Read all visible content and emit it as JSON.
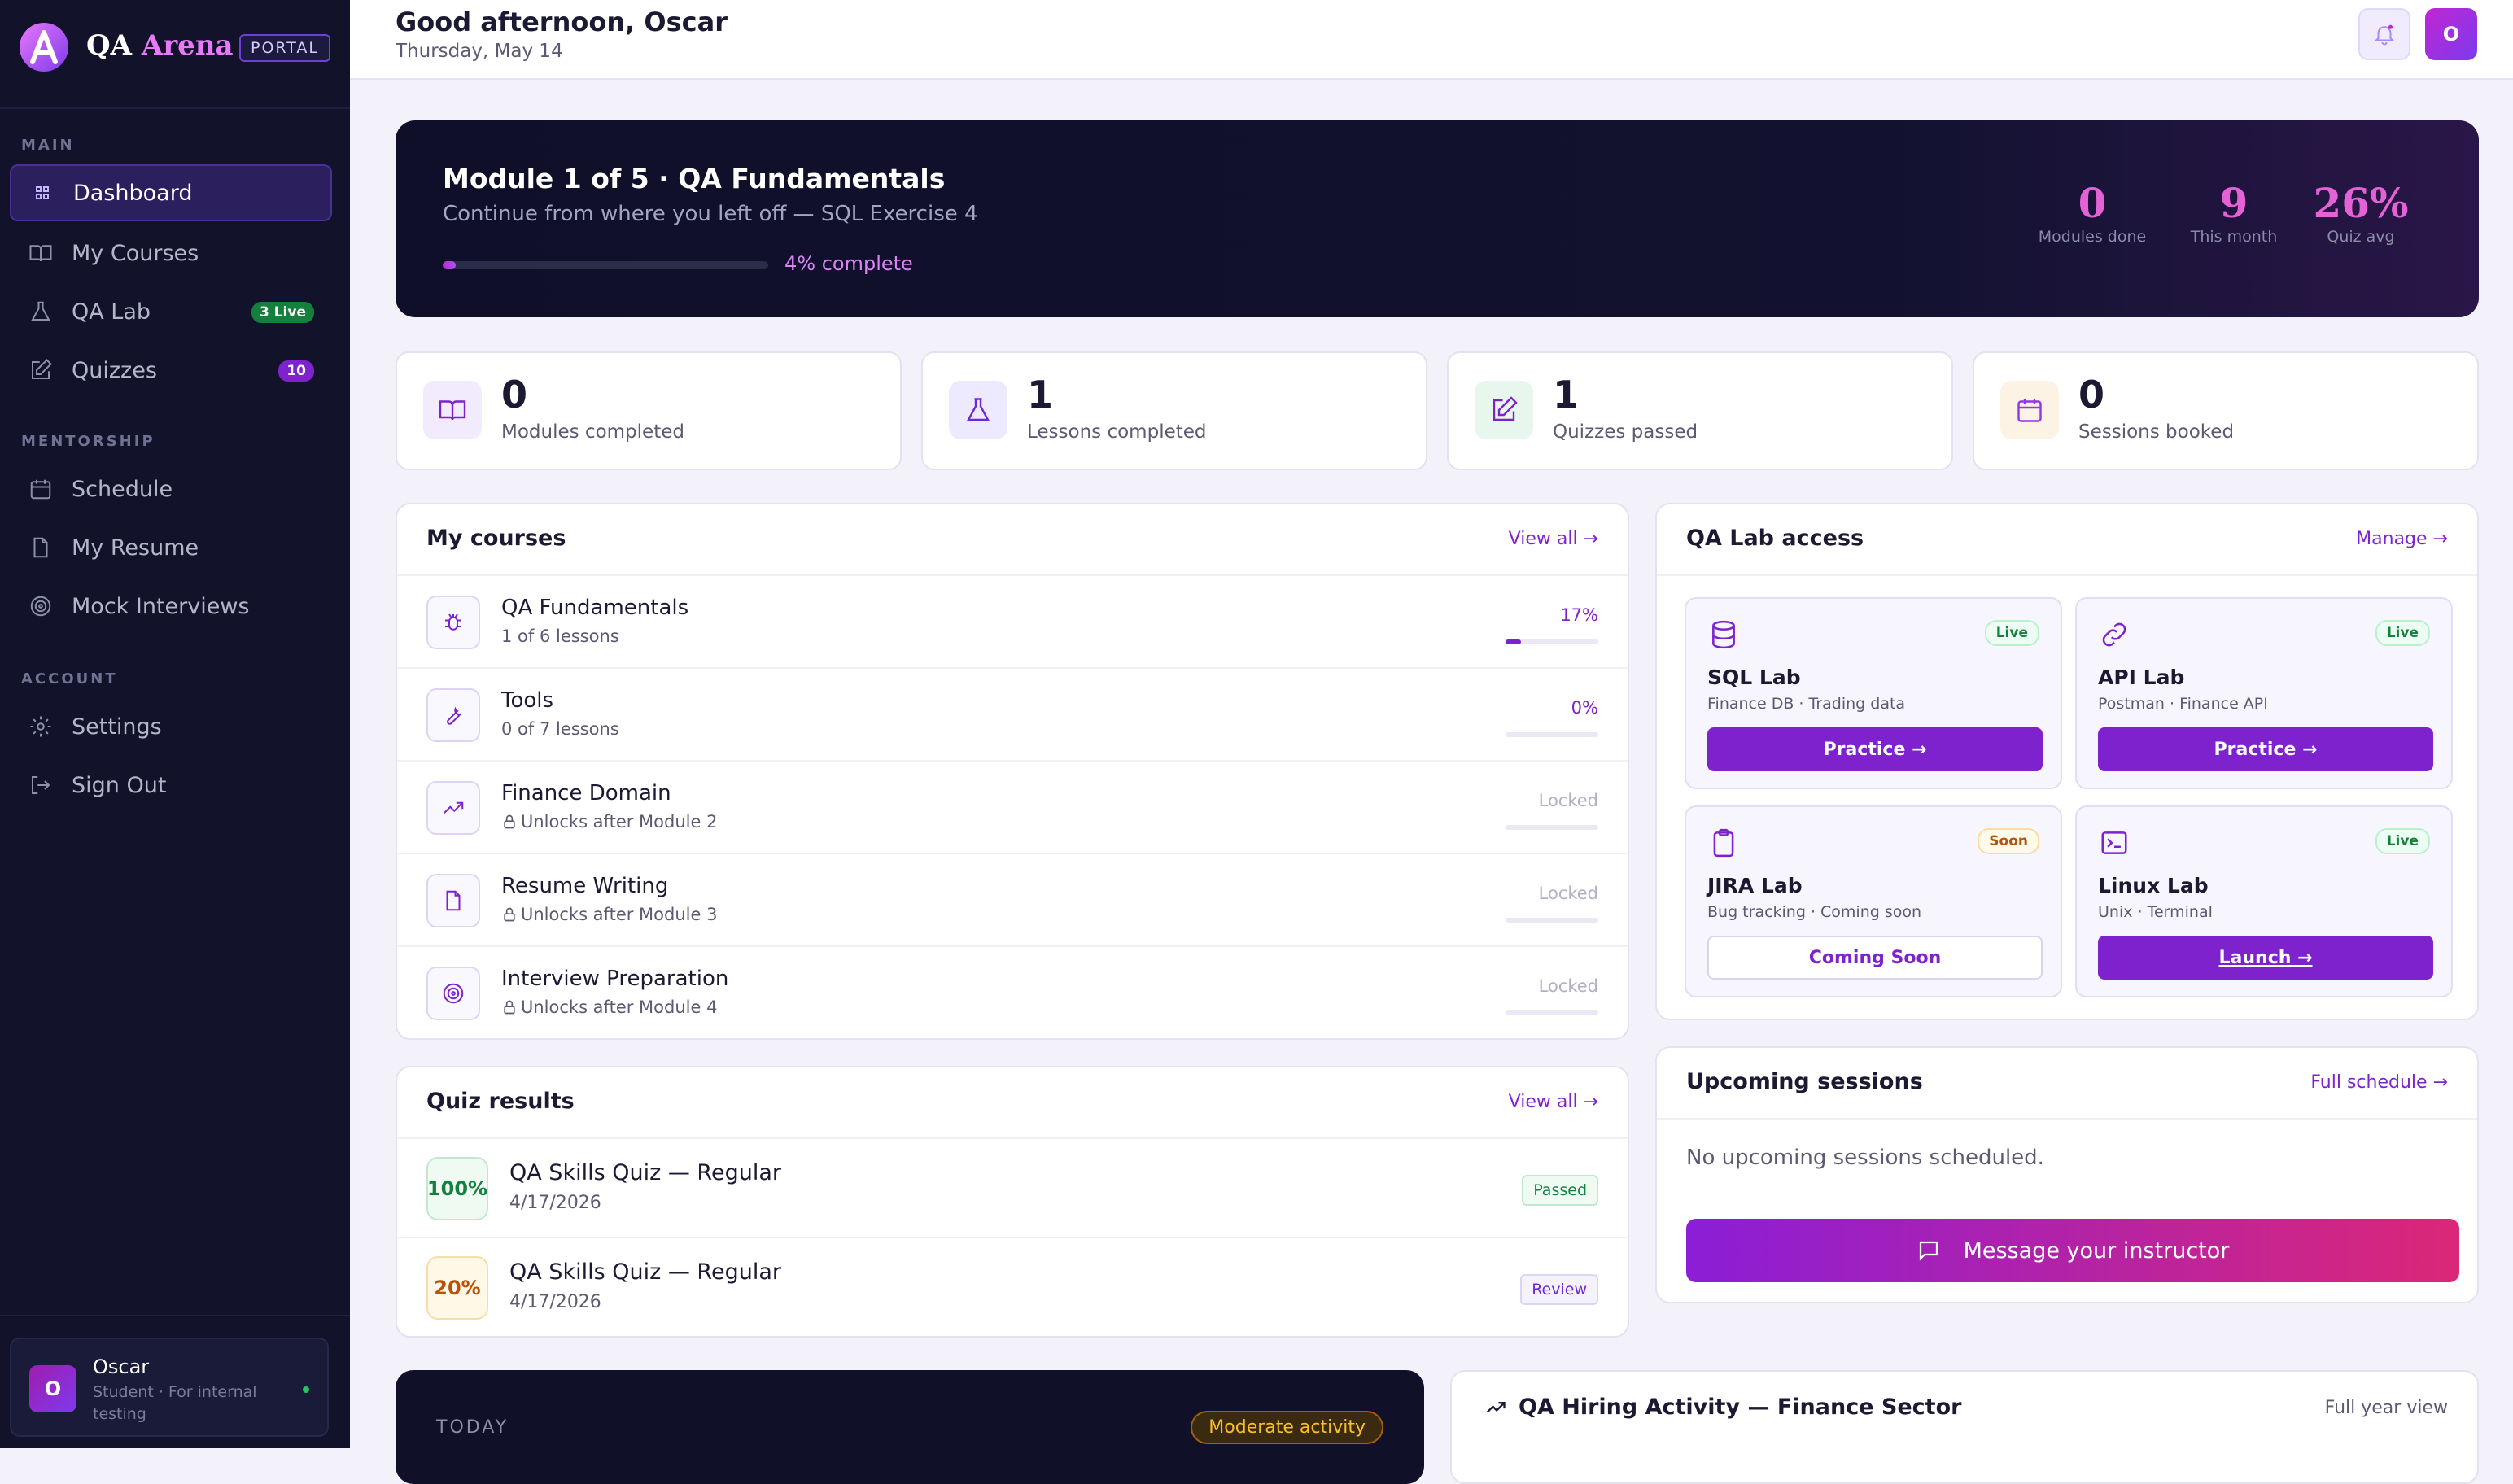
{
  "brand": {
    "name_a": "QA",
    "name_b": "Arena",
    "badge": "PORTAL"
  },
  "sidebar": {
    "sections": [
      {
        "label": "MAIN"
      },
      {
        "label": "MENTORSHIP"
      },
      {
        "label": "ACCOUNT"
      }
    ],
    "items": [
      {
        "label": "Dashboard",
        "icon": "grid-icon"
      },
      {
        "label": "My Courses",
        "icon": "book-icon"
      },
      {
        "label": "QA Lab",
        "icon": "flask-icon",
        "badge": "3 Live"
      },
      {
        "label": "Quizzes",
        "icon": "edit-icon",
        "badge": "10"
      },
      {
        "label": "Schedule",
        "icon": "calendar-icon"
      },
      {
        "label": "My Resume",
        "icon": "document-icon"
      },
      {
        "label": "Mock Interviews",
        "icon": "target-icon"
      },
      {
        "label": "Settings",
        "icon": "gear-icon"
      },
      {
        "label": "Sign Out",
        "icon": "sign-out-icon"
      }
    ],
    "user": {
      "initial": "O",
      "name": "Oscar",
      "role": "Student · For internal testing"
    }
  },
  "header": {
    "greeting": "Good afternoon, Oscar",
    "date": "Thursday, May 14",
    "avatar_initial": "O"
  },
  "hero": {
    "title": "Module 1 of 5 · QA Fundamentals",
    "subtitle": "Continue from where you left off — SQL Exercise 4",
    "progress": 0.04,
    "progress_label": "4% complete",
    "stats": [
      {
        "value": "0",
        "label": "Modules done"
      },
      {
        "value": "9",
        "label": "This month"
      },
      {
        "value": "26%",
        "label": "Quiz avg"
      }
    ]
  },
  "stat_cards": [
    {
      "value": "0",
      "label": "Modules completed",
      "icon": "book-icon"
    },
    {
      "value": "1",
      "label": "Lessons completed",
      "icon": "flask-icon"
    },
    {
      "value": "1",
      "label": "Quizzes passed",
      "icon": "edit-icon"
    },
    {
      "value": "0",
      "label": "Sessions booked",
      "icon": "calendar-icon"
    }
  ],
  "courses": {
    "title": "My courses",
    "link": "View all →",
    "items": [
      {
        "name": "QA Fundamentals",
        "sub": "1 of 6 lessons",
        "status": "17%",
        "progress": 0.17,
        "locked": false,
        "icon": "bug-icon"
      },
      {
        "name": "Tools",
        "sub": "0 of 7 lessons",
        "status": "0%",
        "progress": 0,
        "locked": false,
        "icon": "wrench-icon"
      },
      {
        "name": "Finance Domain",
        "sub": "Unlocks after Module 2",
        "status": "Locked",
        "progress": 0,
        "locked": true,
        "icon": "trend-icon"
      },
      {
        "name": "Resume Writing",
        "sub": "Unlocks after Module 3",
        "status": "Locked",
        "progress": 0,
        "locked": true,
        "icon": "document-icon"
      },
      {
        "name": "Interview Preparation",
        "sub": "Unlocks after Module 4",
        "status": "Locked",
        "progress": 0,
        "locked": true,
        "icon": "target-icon"
      }
    ]
  },
  "quizzes": {
    "title": "Quiz results",
    "link": "View all →",
    "items": [
      {
        "score": "100%",
        "name": "QA Skills Quiz — Regular",
        "date": "4/17/2026",
        "badge": "Passed"
      },
      {
        "score": "20%",
        "name": "QA Skills Quiz — Regular",
        "date": "4/17/2026",
        "badge": "Review"
      }
    ]
  },
  "lab": {
    "title": "QA Lab access",
    "link": "Manage →",
    "cards": [
      {
        "name": "SQL Lab",
        "sub": "Finance DB · Trading data",
        "tag": "Live",
        "button": "Practice →",
        "icon": "database-icon"
      },
      {
        "name": "API Lab",
        "sub": "Postman · Finance API",
        "tag": "Live",
        "button": "Practice →",
        "icon": "link-icon"
      },
      {
        "name": "JIRA Lab",
        "sub": "Bug tracking · Coming soon",
        "tag": "Soon",
        "button": "Coming Soon",
        "icon": "clipboard-icon"
      },
      {
        "name": "Linux Lab",
        "sub": "Unix · Terminal",
        "tag": "Live",
        "button": "Launch →",
        "icon": "terminal-icon"
      }
    ]
  },
  "sessions": {
    "title": "Upcoming sessions",
    "link": "Full schedule →",
    "empty": "No upcoming sessions scheduled.",
    "button": "Message your instructor"
  },
  "today": {
    "label": "TODAY",
    "badge": "Moderate activity"
  },
  "hiring": {
    "title": "QA Hiring Activity — Finance Sector",
    "link": "Full year view"
  },
  "colors": {
    "accent": "#7e22ce",
    "magenta": "#c026d3",
    "sidebar_bg": "#12132b",
    "live_green": "#16a34a",
    "soon_amber": "#d97706"
  }
}
